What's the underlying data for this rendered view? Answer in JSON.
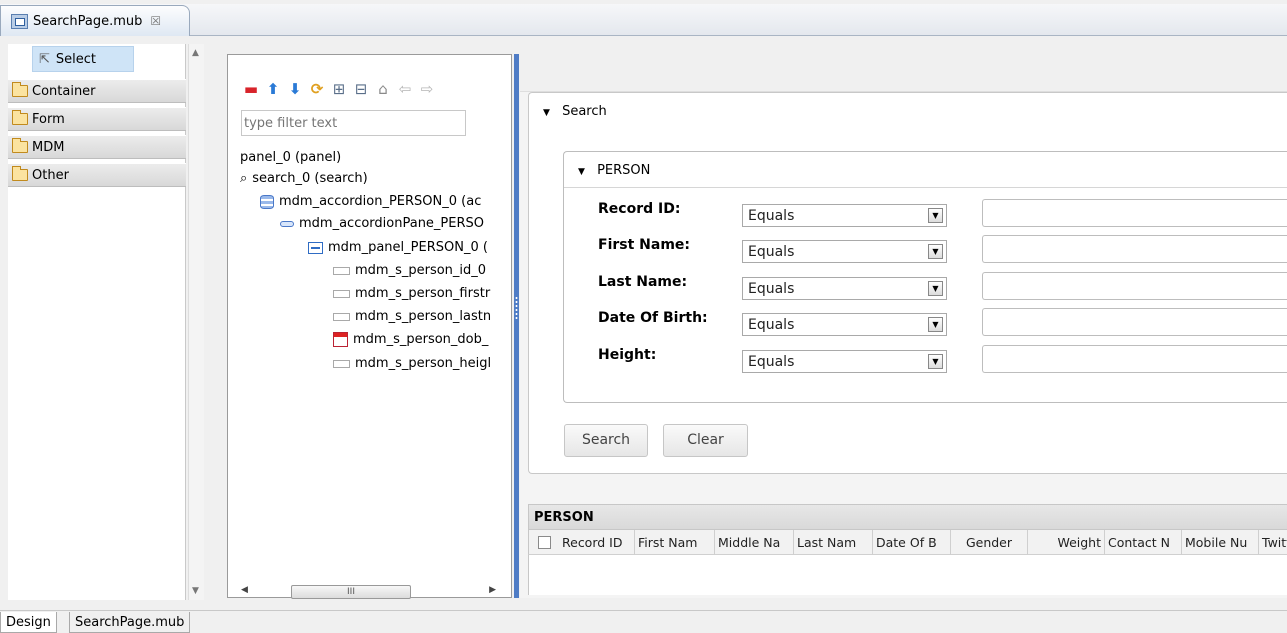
{
  "editor_tab": {
    "title": "SearchPage.mub",
    "close": "☒"
  },
  "palette": {
    "select_label": "Select",
    "drawers": [
      {
        "label": "Container"
      },
      {
        "label": "Form"
      },
      {
        "label": "MDM"
      },
      {
        "label": "Other"
      }
    ]
  },
  "outline": {
    "filter_placeholder": "type filter text",
    "tree": [
      {
        "label": "panel_0 (panel)",
        "icon": "none"
      },
      {
        "label": "search_0 (search)",
        "icon": "search-icon"
      },
      {
        "label": "mdm_accordion_PERSON_0 (ac",
        "icon": "accordion-icon"
      },
      {
        "label": "mdm_accordionPane_PERSO",
        "icon": "accordion-pane-icon"
      },
      {
        "label": "mdm_panel_PERSON_0 (",
        "icon": "panel-icon"
      },
      {
        "label": "mdm_s_person_id_0",
        "icon": "text-field-icon"
      },
      {
        "label": "mdm_s_person_firstr",
        "icon": "text-field-icon"
      },
      {
        "label": "mdm_s_person_lastn",
        "icon": "text-field-icon"
      },
      {
        "label": "mdm_s_person_dob_",
        "icon": "calendar-icon"
      },
      {
        "label": "mdm_s_person_heigl",
        "icon": "text-field-icon"
      }
    ],
    "scroll_thumb": "III"
  },
  "preview": {
    "search_header": "Search",
    "person_header": "PERSON",
    "fields": [
      {
        "label": "Record ID:",
        "operator": "Equals"
      },
      {
        "label": "First Name:",
        "operator": "Equals"
      },
      {
        "label": "Last Name:",
        "operator": "Equals"
      },
      {
        "label": "Date Of Birth:",
        "operator": "Equals"
      },
      {
        "label": "Height:",
        "operator": "Equals"
      }
    ],
    "search_button": "Search",
    "clear_button": "Clear",
    "grid_title": "PERSON",
    "grid_columns": [
      "Record ID",
      "First Nam",
      "Middle Na",
      "Last Nam",
      "Date Of B",
      "Gender",
      "Weight",
      "Contact N",
      "Mobile Nu",
      "Twitt"
    ]
  },
  "bottom_tabs": {
    "design": "Design",
    "source": "SearchPage.mub"
  }
}
